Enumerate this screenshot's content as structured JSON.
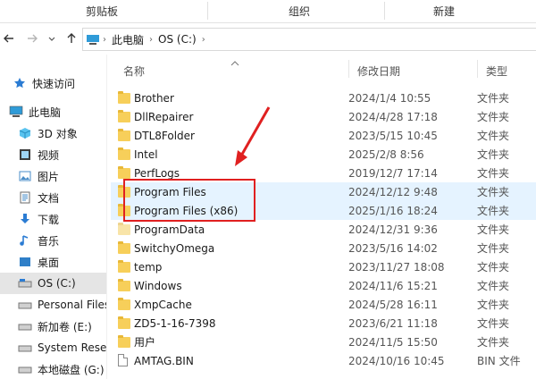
{
  "ribbon": {
    "groups": [
      "剪贴板",
      "组织",
      "新建"
    ]
  },
  "nav": {
    "back_icon": "arrow-left-icon",
    "forward_icon": "arrow-right-icon",
    "recent_icon": "chevron-down-icon",
    "up_icon": "arrow-up-icon",
    "breadcrumbs": [
      "此电脑",
      "OS (C:)"
    ]
  },
  "sidebar": {
    "items": [
      {
        "label": "快速访问",
        "icon": "star-icon"
      },
      {
        "label": "此电脑",
        "icon": "computer-icon"
      },
      {
        "label": "3D 对象",
        "icon": "cube-icon"
      },
      {
        "label": "视频",
        "icon": "video-icon"
      },
      {
        "label": "图片",
        "icon": "picture-icon"
      },
      {
        "label": "文档",
        "icon": "document-icon"
      },
      {
        "label": "下载",
        "icon": "download-icon"
      },
      {
        "label": "音乐",
        "icon": "music-icon"
      },
      {
        "label": "桌面",
        "icon": "desktop-icon"
      },
      {
        "label": "OS (C:)",
        "icon": "drive-icon"
      },
      {
        "label": "Personal Files",
        "icon": "drive-icon"
      },
      {
        "label": "新加卷 (E:)",
        "icon": "drive-icon"
      },
      {
        "label": "System Reser",
        "icon": "drive-icon"
      },
      {
        "label": "本地磁盘 (G:)",
        "icon": "drive-icon"
      }
    ]
  },
  "columns": {
    "name": "名称",
    "date": "修改日期",
    "type": "类型"
  },
  "files": [
    {
      "name": "Brother",
      "date": "2024/1/4 10:55",
      "type": "文件夹",
      "kind": "folder"
    },
    {
      "name": "DllRepairer",
      "date": "2024/4/28 17:18",
      "type": "文件夹",
      "kind": "folder"
    },
    {
      "name": "DTL8Folder",
      "date": "2023/5/15 10:45",
      "type": "文件夹",
      "kind": "folder"
    },
    {
      "name": "Intel",
      "date": "2025/2/8 8:56",
      "type": "文件夹",
      "kind": "folder"
    },
    {
      "name": "PerfLogs",
      "date": "2019/12/7 17:14",
      "type": "文件夹",
      "kind": "folder"
    },
    {
      "name": "Program Files",
      "date": "2024/12/12 9:48",
      "type": "文件夹",
      "kind": "folder"
    },
    {
      "name": "Program Files (x86)",
      "date": "2025/1/16 18:24",
      "type": "文件夹",
      "kind": "folder"
    },
    {
      "name": "ProgramData",
      "date": "2024/12/31 9:36",
      "type": "文件夹",
      "kind": "folder-hidden"
    },
    {
      "name": "SwitchyOmega",
      "date": "2023/5/16 14:02",
      "type": "文件夹",
      "kind": "folder"
    },
    {
      "name": "temp",
      "date": "2023/11/27 18:08",
      "type": "文件夹",
      "kind": "folder"
    },
    {
      "name": "Windows",
      "date": "2024/11/6 15:21",
      "type": "文件夹",
      "kind": "folder"
    },
    {
      "name": "XmpCache",
      "date": "2024/5/28 16:11",
      "type": "文件夹",
      "kind": "folder"
    },
    {
      "name": "ZD5-1-16-7398",
      "date": "2023/6/21 11:18",
      "type": "文件夹",
      "kind": "folder"
    },
    {
      "name": "用户",
      "date": "2024/11/5 15:50",
      "type": "文件夹",
      "kind": "folder"
    },
    {
      "name": "AMTAG.BIN",
      "date": "2024/10/16 10:45",
      "type": "BIN 文件",
      "kind": "file"
    }
  ],
  "highlight_color": "#e5f3ff",
  "annotation_color": "#e02020"
}
